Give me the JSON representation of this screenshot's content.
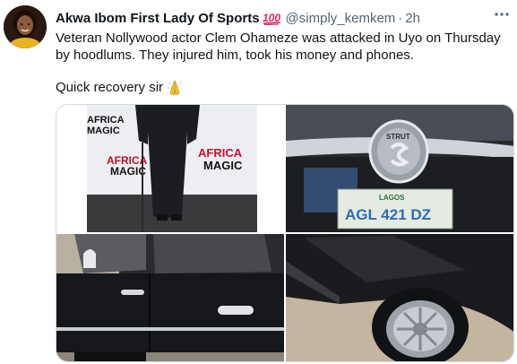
{
  "tweet": {
    "author_name": "Akwa Ibom First Lady Of Sports",
    "author_emoji": "hundred-points-icon",
    "handle": "@simply_kemkem",
    "separator": "·",
    "time": "2h",
    "text_line1": "Veteran Nollywood actor Clem Ohameze was attacked in Uyo on Thursday by hoodlums. They injured him, took his money and phones.",
    "text_line2": "Quick recovery sir",
    "text_emoji": "folded-hands-icon"
  },
  "media": {
    "photo1": {
      "backdrop_logo_line1": "AFRICA",
      "backdrop_logo_line2": "MAGIC",
      "backdrop_logo_small": "AFRICA",
      "backdrop_logo_small2": "MAGIC"
    },
    "photo2": {
      "emblem_text": "STRUT",
      "plate_state": "LAGOS",
      "plate_number": "AGL 421 DZ"
    }
  },
  "colors": {
    "text_primary": "#0f1419",
    "text_secondary": "#536471",
    "border": "#cfd9de",
    "hundred_red": "#e0245e",
    "pray_yellow": "#f4c430"
  }
}
